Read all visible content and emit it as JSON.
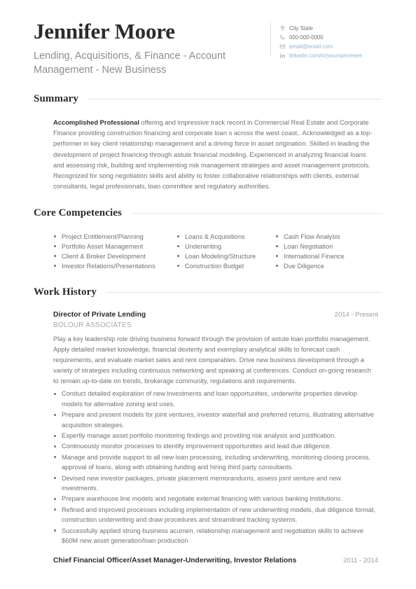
{
  "header": {
    "full_name": "Jennifer Moore",
    "headline": "Lending, Acquisitions, & Finance - Account Management - New Business",
    "contact": [
      {
        "icon": "map-pin-icon",
        "text": "City State",
        "is_link": false
      },
      {
        "icon": "phone-icon",
        "text": "000-000-0000",
        "is_link": false
      },
      {
        "icon": "envelope-icon",
        "text": "email@email.com",
        "is_link": true
      },
      {
        "icon": "linkedin-icon",
        "text": "linkedin.com/in/yournamehere",
        "is_link": true
      }
    ]
  },
  "sections": {
    "summary": {
      "title": "Summary",
      "lead": "Accomplished Professional",
      "body": " offering and impressive track record in Commercial Real Estate and Corporate Finance providing construction financing and corporate loan s across the west coast.. Acknowledged as a top-performer in key client relationship management and a driving force in asset origination. Skilled in leading the development of project financing through astute financial modeling. Experienced in analyzing financial loans and assessing risk, building and implementing risk management strategies and asset management protocols. Recognized for song negotiation skills and ability to foster collaborative relationships with clients, external consultants, legal professionals, loan committee and regulatory authorities."
    },
    "competencies": {
      "title": "Core Competencies",
      "columns": [
        [
          "Project Entitlement/Planning",
          "Portfolio Asset Management",
          "Client & Broker Development",
          "Investor Relations/Presentations"
        ],
        [
          "Loans & Acquisitions",
          "Underwriting",
          "Loan Modeling/Structure",
          "Construction Budget"
        ],
        [
          "Cash Flow Analysis",
          "Loan Negotiation",
          "International Finance",
          "Due Diligence"
        ]
      ]
    },
    "work_history": {
      "title": "Work History",
      "jobs": [
        {
          "title": "Director of Private Lending",
          "dates": "2014 - Present",
          "company": "BOLOUR ASSOCIATES",
          "description": "Play a key leadership role driving business forward through the provision of astute loan portfolio management. Apply detailed market knowledge, financial dexterity and exemplary analytical skills to forecast cash requirements, and evaluate market sales and rent comparables. Drive new business development through a variety of strategies including continuous networking and speaking at conferences. Conduct on-going research to remain up-to-date on trends, brokerage community, regulations and requirements.",
          "bullets": [
            "Conduct detailed exploration of new investments and loan opportunities, underwrite properties develop models for alternative zoning and uses.",
            "Prepare and present models for joint ventures, investor waterfall and preferred returns, illustrating alternative acquisition strategies.",
            "Expertly manage asset portfolio monitoring findings and providing risk analysis and justification.",
            "Continuously monitor processes to identify improvement opportunities and lead due diligence.",
            "Manage and provide support to all new loan processing, including underwriting, monitoring closing process, approval of loans, along with obtaining funding and hiring third party consultants.",
            "Devised new investor packages, private placement memorandums, assess joint venture and new investments.",
            "Prepare warehouse line models and negotiate external financing with various banking institutions.",
            "Refined and improved processes including implementation of new underwriting models, due diligence format, construction underwriting and draw procedures and streamlined tracking systems.",
            "Successfully applied strong business acumen, relationship management and negotiation skills to achieve $60M new asset generation/loan production"
          ]
        },
        {
          "title": "Chief Financial Officer/Asset Manager-Underwriting, Investor Relations",
          "dates": "2011 - 2014",
          "company": "",
          "description": "",
          "bullets": []
        }
      ]
    }
  },
  "colors": {
    "name": "#2b2b2b",
    "body_text": "#6f7173",
    "muted": "#a4a6a8",
    "link": "#8fb4d9",
    "rule": "#e4e5e6"
  }
}
